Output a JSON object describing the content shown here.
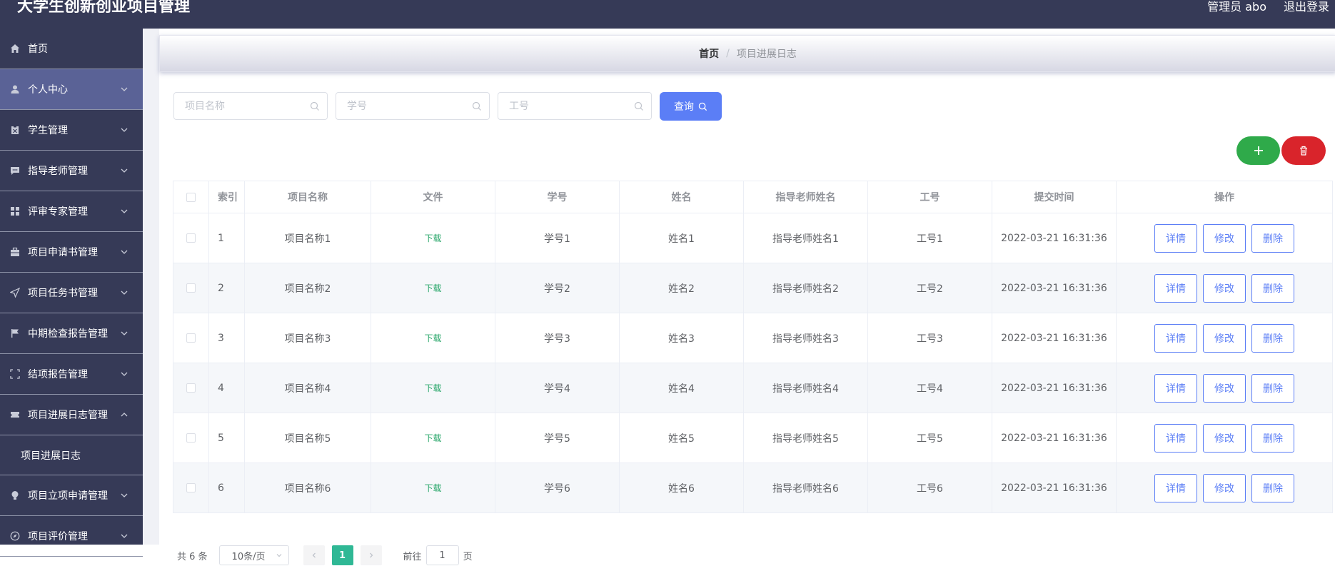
{
  "header": {
    "title": "大学生创新创业项目管理",
    "user": "管理员 abo",
    "logout": "退出登录"
  },
  "sidebar": {
    "items": [
      {
        "label": "首页",
        "icon": "home-icon"
      },
      {
        "label": "个人中心",
        "icon": "user-icon"
      },
      {
        "label": "学生管理",
        "icon": "clipboard-icon"
      },
      {
        "label": "指导老师管理",
        "icon": "chat-icon"
      },
      {
        "label": "评审专家管理",
        "icon": "grid-icon"
      },
      {
        "label": "项目申请书管理",
        "icon": "briefcase-icon"
      },
      {
        "label": "项目任务书管理",
        "icon": "send-icon"
      },
      {
        "label": "中期检查报告管理",
        "icon": "flag-icon"
      },
      {
        "label": "结项报告管理",
        "icon": "frame-icon"
      },
      {
        "label": "项目进展日志管理",
        "icon": "ticket-icon"
      },
      {
        "label": "项目立项申请管理",
        "icon": "bulb-icon"
      },
      {
        "label": "项目评价管理",
        "icon": "compass-icon"
      }
    ],
    "submenu": {
      "label": "项目进展日志"
    }
  },
  "breadcrumb": {
    "home": "首页",
    "sep": "/",
    "current": "项目进展日志"
  },
  "search": {
    "project_placeholder": "项目名称",
    "student_no_placeholder": "学号",
    "staff_no_placeholder": "工号",
    "query_label": "查询"
  },
  "table": {
    "headers": [
      "索引",
      "项目名称",
      "文件",
      "学号",
      "姓名",
      "指导老师姓名",
      "工号",
      "提交时间",
      "操作"
    ],
    "rows": [
      {
        "idx": "1",
        "name": "项目名称1",
        "file": "下载",
        "sno": "学号1",
        "sname": "姓名1",
        "tname": "指导老师姓名1",
        "tno": "工号1",
        "time": "2022-03-21 16:31:36"
      },
      {
        "idx": "2",
        "name": "项目名称2",
        "file": "下载",
        "sno": "学号2",
        "sname": "姓名2",
        "tname": "指导老师姓名2",
        "tno": "工号2",
        "time": "2022-03-21 16:31:36"
      },
      {
        "idx": "3",
        "name": "项目名称3",
        "file": "下载",
        "sno": "学号3",
        "sname": "姓名3",
        "tname": "指导老师姓名3",
        "tno": "工号3",
        "time": "2022-03-21 16:31:36"
      },
      {
        "idx": "4",
        "name": "项目名称4",
        "file": "下载",
        "sno": "学号4",
        "sname": "姓名4",
        "tname": "指导老师姓名4",
        "tno": "工号4",
        "time": "2022-03-21 16:31:36"
      },
      {
        "idx": "5",
        "name": "项目名称5",
        "file": "下载",
        "sno": "学号5",
        "sname": "姓名5",
        "tname": "指导老师姓名5",
        "tno": "工号5",
        "time": "2022-03-21 16:31:36"
      },
      {
        "idx": "6",
        "name": "项目名称6",
        "file": "下载",
        "sno": "学号6",
        "sname": "姓名6",
        "tname": "指导老师姓名6",
        "tno": "工号6",
        "time": "2022-03-21 16:31:36"
      }
    ],
    "ops": {
      "detail": "详情",
      "edit": "修改",
      "delete": "删除"
    }
  },
  "pagination": {
    "total": "共 6 条",
    "page_size": "10条/页",
    "current_page": "1",
    "goto_label": "前往",
    "goto_value": "1",
    "page_suffix": "页"
  },
  "colors": {
    "header_bg": "#363a57",
    "sidebar_active": "#5a6296",
    "primary": "#5b7ef6",
    "add": "#2faa4a",
    "delete": "#d9242b",
    "download": "#2ca86c",
    "page_active": "#2fb895"
  }
}
